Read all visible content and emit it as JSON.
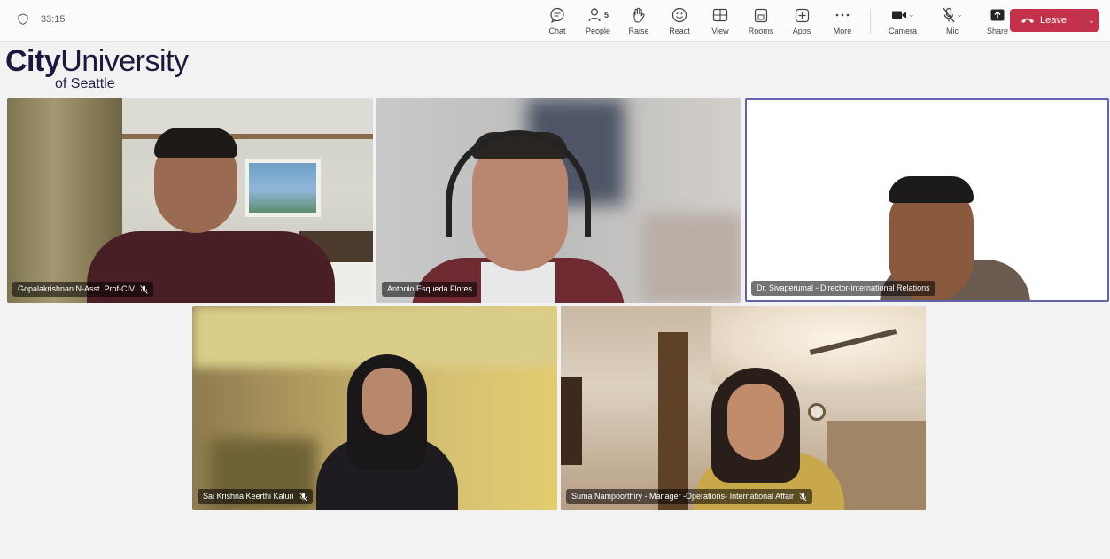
{
  "meeting": {
    "timer": "33:15"
  },
  "toolbar": {
    "items": [
      {
        "label": "Chat",
        "icon": "chat-icon"
      },
      {
        "label": "People",
        "icon": "people-icon",
        "badge": "5"
      },
      {
        "label": "Raise",
        "icon": "raise-hand-icon"
      },
      {
        "label": "React",
        "icon": "react-icon"
      },
      {
        "label": "View",
        "icon": "view-grid-icon"
      },
      {
        "label": "Rooms",
        "icon": "rooms-icon"
      },
      {
        "label": "Apps",
        "icon": "apps-icon"
      },
      {
        "label": "More",
        "icon": "more-icon"
      }
    ],
    "camera_label": "Camera",
    "mic_label": "Mic",
    "share_label": "Share",
    "leave_label": "Leave"
  },
  "logo": {
    "line1_bold": "City",
    "line1_rest": "University",
    "line2": "of Seattle",
    "color": "#1b1a3d"
  },
  "participants": [
    {
      "name": "Gopalakrishnan N-Asst. Prof-CIV",
      "muted": true
    },
    {
      "name": "Antonio Esqueda Flores",
      "muted": false
    },
    {
      "name": "Dr. Sivaperumal - Director-international Relations",
      "muted": false,
      "active_speaker": true
    },
    {
      "name": "Sai Krishna Keerthi Kaluri",
      "muted": true
    },
    {
      "name": "Suma Nampoorthiry - Manager -Operations- International Affair",
      "muted": true
    }
  ],
  "colors": {
    "leave": "#c4314b",
    "active_border": "#6264a7"
  }
}
